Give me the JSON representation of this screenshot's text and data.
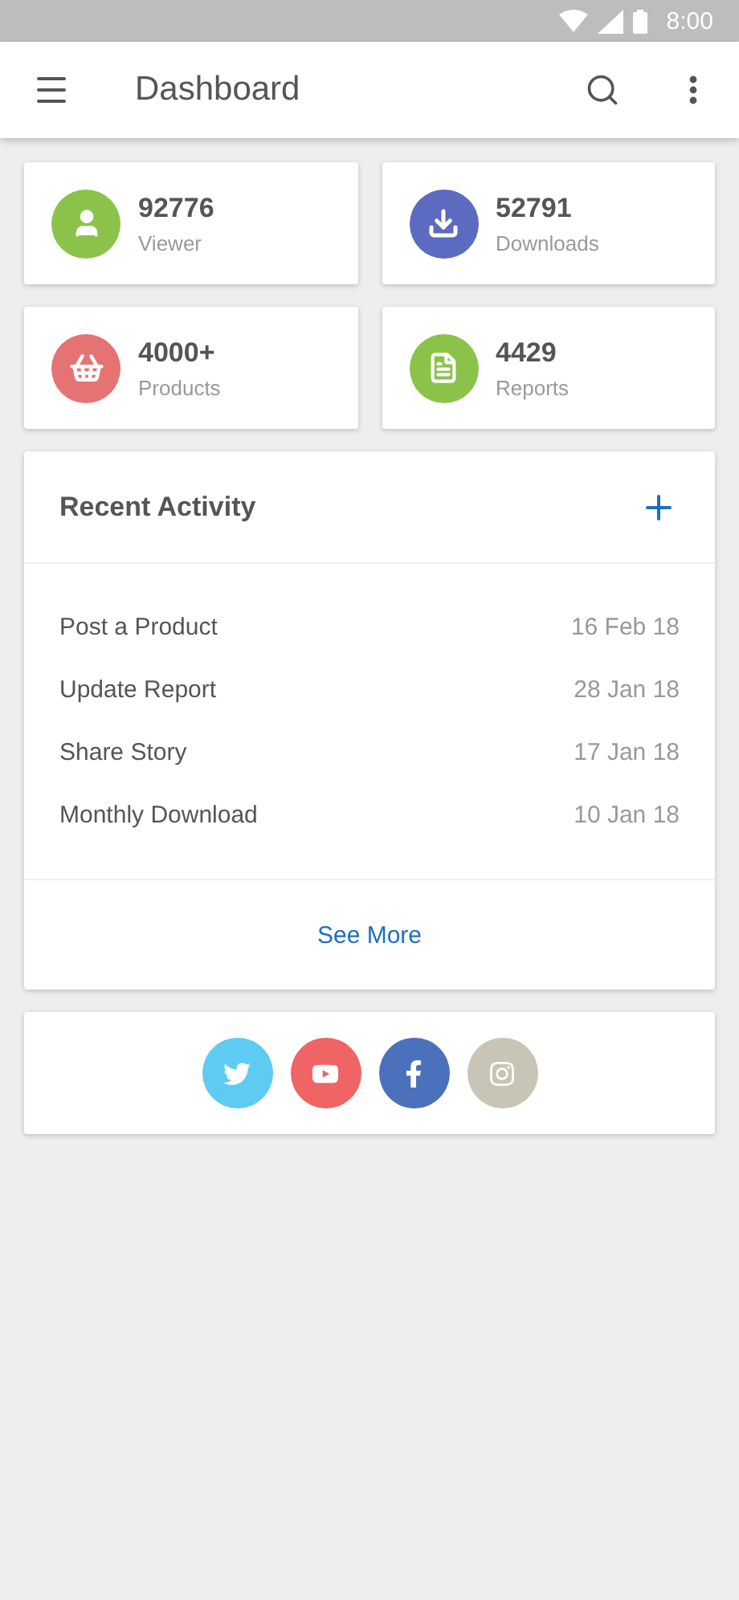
{
  "status_bar": {
    "time": "8:00"
  },
  "app_bar": {
    "title": "Dashboard"
  },
  "stats": [
    {
      "value": "92776",
      "label": "Viewer",
      "kind": "user",
      "color": "#8bc34a"
    },
    {
      "value": "52791",
      "label": "Downloads",
      "kind": "download",
      "color": "#5c6bc0"
    },
    {
      "value": "4000+",
      "label": "Products",
      "kind": "basket",
      "color": "#e57373"
    },
    {
      "value": "4429",
      "label": "Reports",
      "kind": "report",
      "color": "#8bc34a"
    }
  ],
  "recent_activity": {
    "title": "Recent Activity",
    "items": [
      {
        "name": "Post a Product",
        "date": "16 Feb 18"
      },
      {
        "name": "Update Report",
        "date": "28 Jan 18"
      },
      {
        "name": "Share Story",
        "date": "17 Jan 18"
      },
      {
        "name": "Monthly Download",
        "date": "10 Jan 18"
      }
    ],
    "link": "See More"
  },
  "social": [
    {
      "kind": "twitter",
      "color": "#5ecbf3"
    },
    {
      "kind": "youtube",
      "color": "#ef6464"
    },
    {
      "kind": "facebook",
      "color": "#4b71bd"
    },
    {
      "kind": "instagram",
      "color": "#c8c5b6"
    }
  ]
}
